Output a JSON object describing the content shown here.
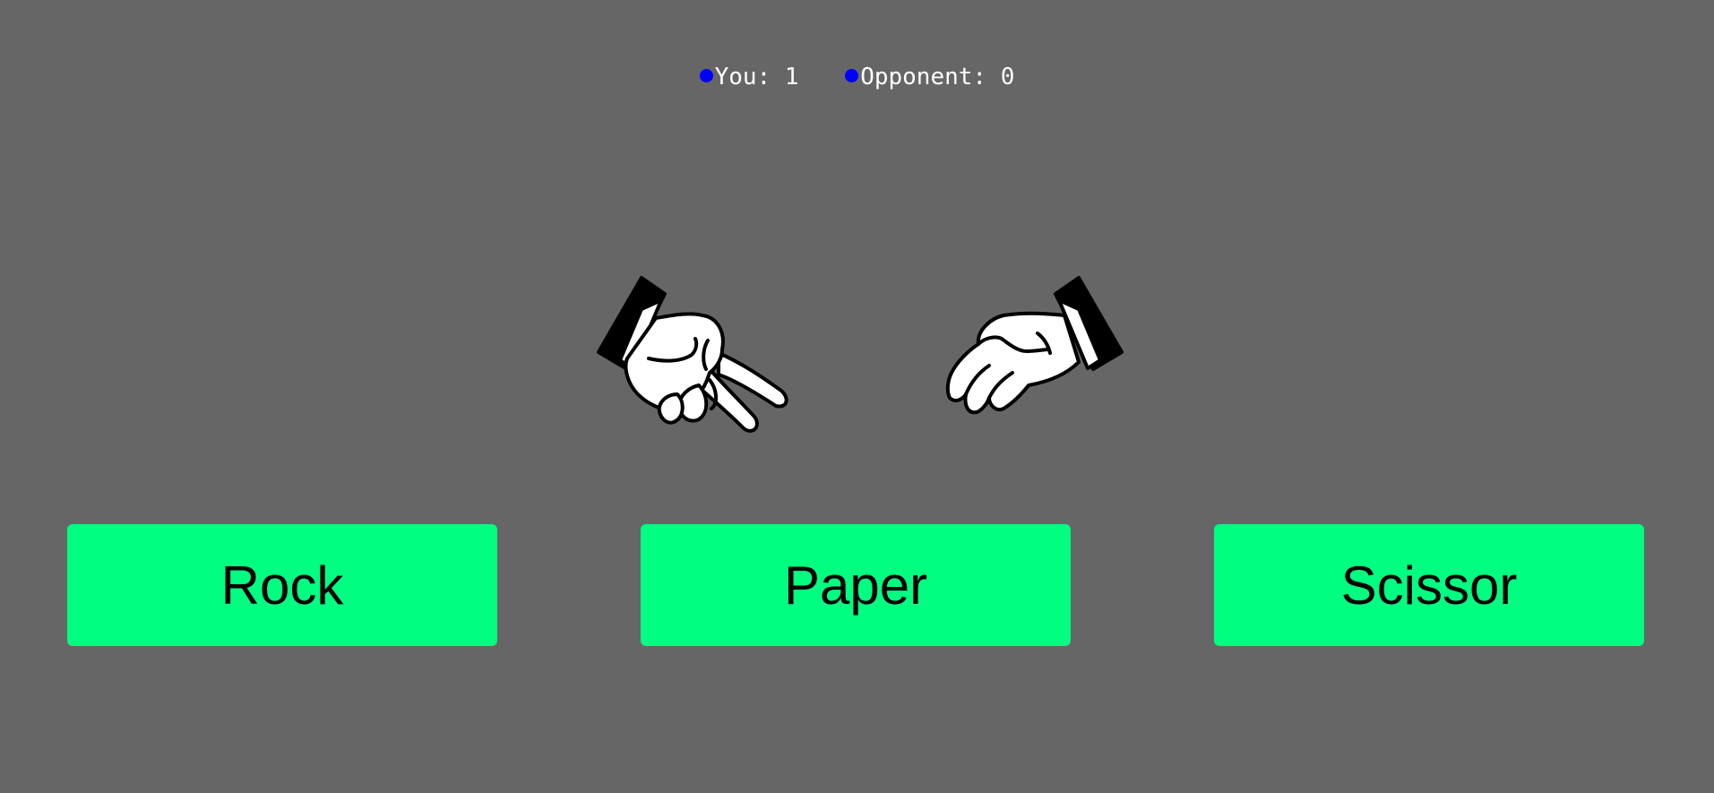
{
  "scoreboard": {
    "you_label": "You: 1",
    "opponent_label": "Opponent: 0",
    "you_score": 1,
    "opponent_score": 0,
    "dot_color": "#0000ff"
  },
  "hands": {
    "player_choice": "scissor",
    "opponent_choice": "paper"
  },
  "buttons": {
    "rock": "Rock",
    "paper": "Paper",
    "scissor": "Scissor"
  },
  "colors": {
    "background": "#666666",
    "button": "#00ff80",
    "button_text": "#000000",
    "score_text": "#ffffff"
  }
}
